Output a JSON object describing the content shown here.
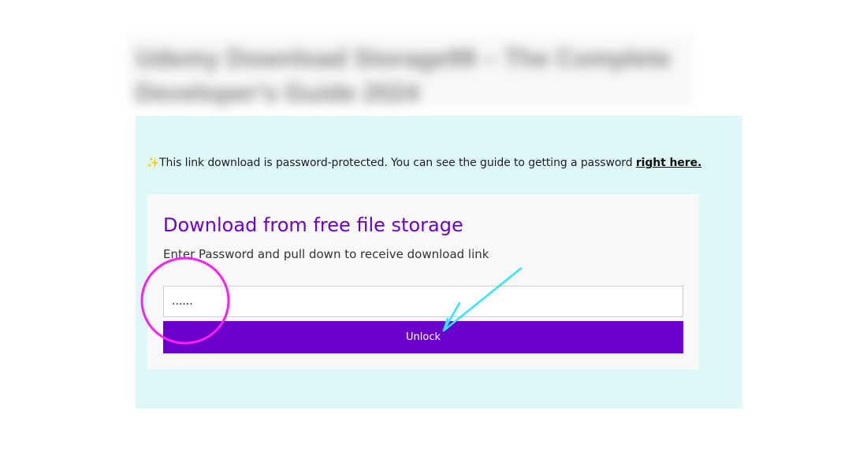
{
  "page": {
    "blurred_heading": "Udemy Download Storage99 – The Complete Developer's Guide 2024"
  },
  "notice": {
    "sparkle": "✨",
    "text": "This link download is password-protected. You can see the guide to getting a password ",
    "link_label": "right here."
  },
  "card": {
    "title": "Download from free file storage",
    "subtitle": "Enter Password and pull down to receive download link",
    "password_value": "......",
    "unlock_label": "Unlock"
  },
  "annotations": {
    "circle_color": "#ff1ff0",
    "arrow_color": "#2ee6ff"
  },
  "colors": {
    "panel_bg": "#ddf8f7",
    "accent": "#6b00cc"
  }
}
